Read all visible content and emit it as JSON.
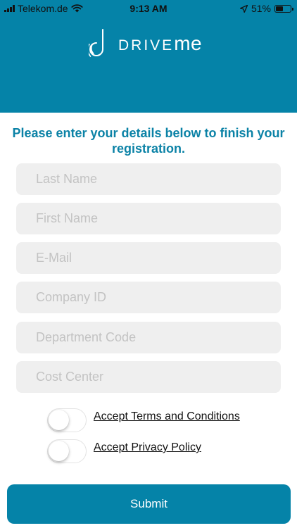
{
  "status_bar": {
    "carrier": "Telekom.de",
    "time": "9:13 AM",
    "battery_percent": "51%",
    "battery_level": 0.51,
    "icons": [
      "signal-icon",
      "wifi-icon",
      "location-icon",
      "battery-icon"
    ]
  },
  "brand": {
    "logo_drive": "DRIVE",
    "logo_me": "me",
    "color": "#0583a8",
    "icon": "driveme-logo-icon"
  },
  "form": {
    "intro": "Please enter your details below to finish your registration.",
    "fields": [
      {
        "placeholder": "Last Name",
        "value": ""
      },
      {
        "placeholder": "First Name",
        "value": ""
      },
      {
        "placeholder": "E-Mail",
        "value": ""
      },
      {
        "placeholder": "Company ID",
        "value": ""
      },
      {
        "placeholder": "Department Code",
        "value": ""
      },
      {
        "placeholder": "Cost Center",
        "value": ""
      }
    ],
    "toggles": [
      {
        "label": "Accept Terms and Conditions",
        "on": false
      },
      {
        "label": "Accept Privacy Policy",
        "on": false
      }
    ],
    "submit_label": "Submit"
  }
}
